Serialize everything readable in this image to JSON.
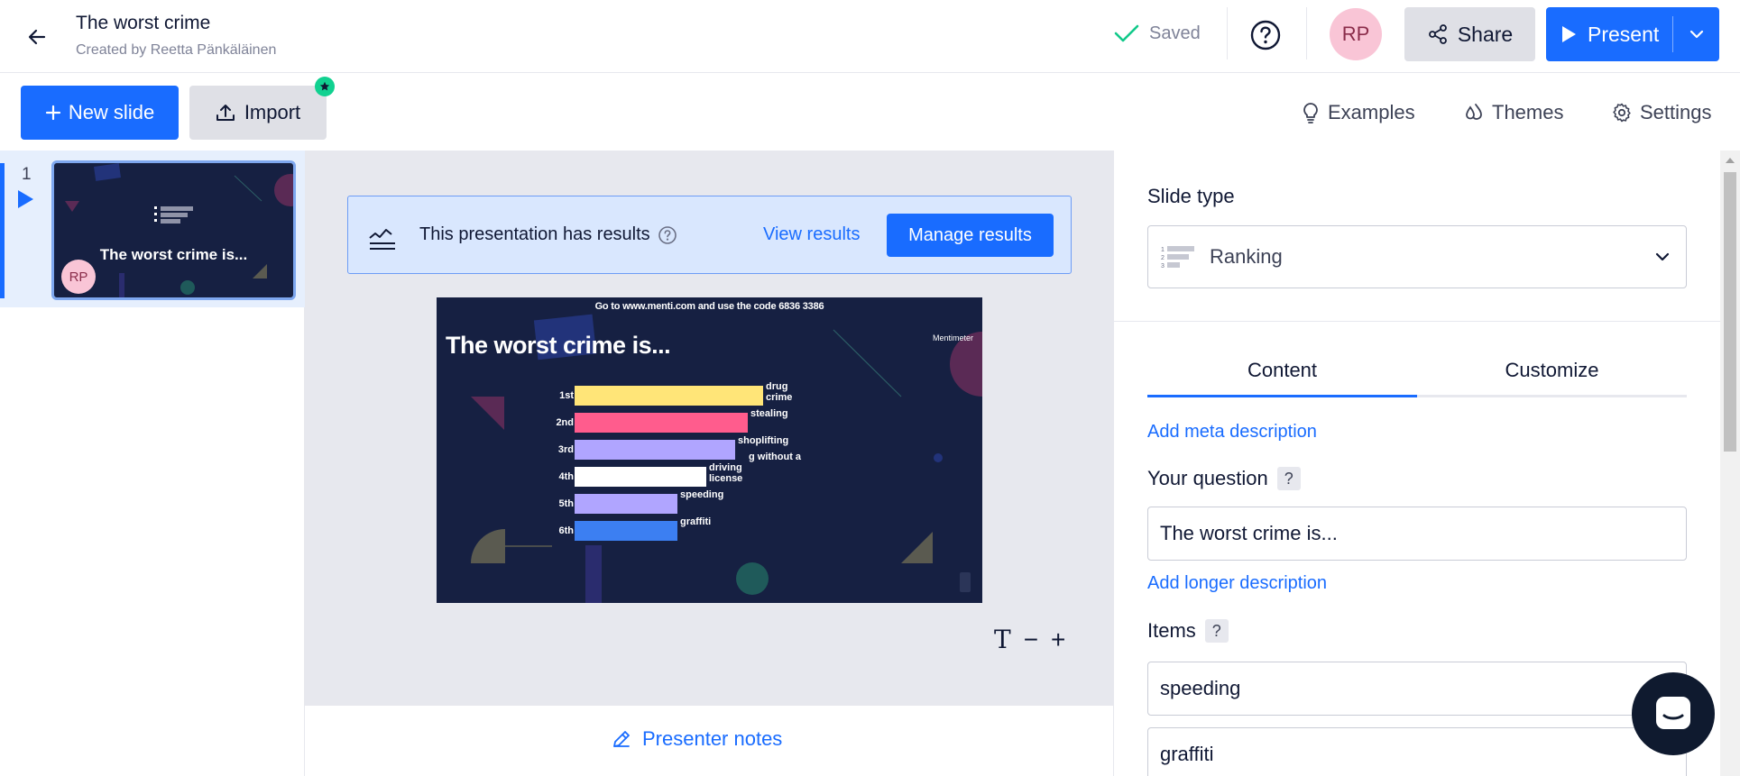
{
  "header": {
    "title": "The worst crime",
    "subtitle": "Created by Reetta Pänkäläinen",
    "saved_label": "Saved",
    "avatar_initials": "RP",
    "share_label": "Share",
    "present_label": "Present"
  },
  "toolbar": {
    "new_slide_label": "New slide",
    "import_label": "Import",
    "examples_label": "Examples",
    "themes_label": "Themes",
    "settings_label": "Settings"
  },
  "slides": [
    {
      "number": "1",
      "title": "The worst crime is...",
      "avatar_initials": "RP"
    }
  ],
  "results_banner": {
    "text": "This presentation has results",
    "view_label": "View results",
    "manage_label": "Manage results"
  },
  "preview": {
    "join_text": "Go to www.menti.com and use the code 6836 3386",
    "title": "The worst crime is...",
    "brand": "Mentimeter",
    "ranking": [
      {
        "rank": "1st",
        "name": "drug crime",
        "value": 0.59,
        "color": "#ffe578"
      },
      {
        "rank": "2nd",
        "name": "stealing",
        "value": 0.54,
        "color": "#ff5c8d"
      },
      {
        "rank": "3rd",
        "name": "shoplifting",
        "value": 0.5,
        "color": "#b0a5ff"
      },
      {
        "rank": "4th",
        "name": "driving license",
        "value": 0.41,
        "color": "#ffffff"
      },
      {
        "rank": "5th",
        "name": "speeding",
        "value": 0.32,
        "color": "#b0a5ff"
      },
      {
        "rank": "6th",
        "name": "graffiti",
        "value": 0.32,
        "color": "#3c7ff2"
      }
    ],
    "overflow_text": "g without a"
  },
  "notes": {
    "label": "Presenter notes"
  },
  "panel": {
    "slide_type_label": "Slide type",
    "slide_type_value": "Ranking",
    "tabs": [
      "Content",
      "Customize"
    ],
    "add_meta_label": "Add meta description",
    "question_label": "Your question",
    "question_value": "The worst crime is...",
    "add_longer_label": "Add longer description",
    "items_label": "Items",
    "items": [
      "speeding",
      "graffiti"
    ],
    "help_badge": "?"
  },
  "colors": {
    "accent": "#196cff",
    "slide_bg": "#162042"
  }
}
